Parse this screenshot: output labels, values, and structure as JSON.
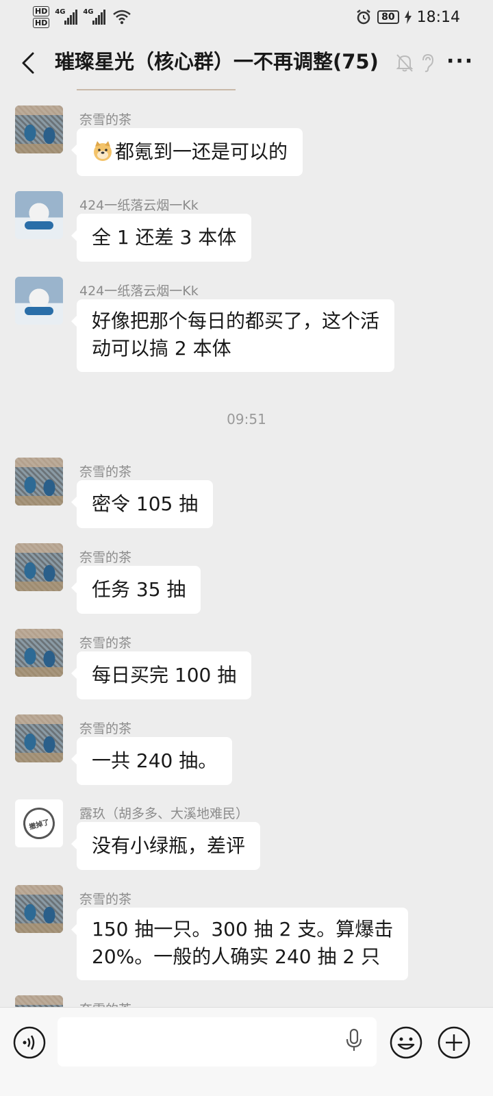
{
  "status_bar": {
    "hd1": "HD",
    "hd2": "HD",
    "net1": "4G",
    "net2": "4G",
    "battery": "80",
    "time": "18:14"
  },
  "header": {
    "title": "璀璨星光（核心群）一不再调整(75)"
  },
  "messages": [
    {
      "sender": "奈雪的茶",
      "text": "都氪到一还是可以的",
      "has_emoji": true
    },
    {
      "sender": "424一纸落云烟一Kk",
      "text": "全 1 还差 3 本体"
    },
    {
      "sender": "424一纸落云烟一Kk",
      "line1": "好像把那个每日的都买了，这个活",
      "line2": "动可以搞 2 本体"
    },
    {
      "time": "09:51"
    },
    {
      "sender": "奈雪的茶",
      "text": "密令 105 抽"
    },
    {
      "sender": "奈雪的茶",
      "text": "任务 35 抽"
    },
    {
      "sender": "奈雪的茶",
      "text": "每日买完 100 抽"
    },
    {
      "sender": "奈雪的茶",
      "text": "一共 240 抽。"
    },
    {
      "sender": "露玖（胡多多、大溪地难民）",
      "text": "没有小绿瓶，差评",
      "stamp_text": "撤掉了"
    },
    {
      "sender": "奈雪的茶",
      "line1": "150 抽一只。300 抽 2 支。算爆击",
      "line2": "20%。一般的人确实 240 抽 2 只"
    },
    {
      "sender": "奈雪的茶"
    }
  ],
  "input": {
    "placeholder": ""
  },
  "icons": {
    "back": "chevron-left-icon",
    "mute": "bell-off-icon",
    "ear": "ear-icon",
    "more": "more-icon",
    "voice": "voice-icon",
    "mic": "mic-icon",
    "emoji": "emoji-icon",
    "plus": "plus-icon"
  }
}
